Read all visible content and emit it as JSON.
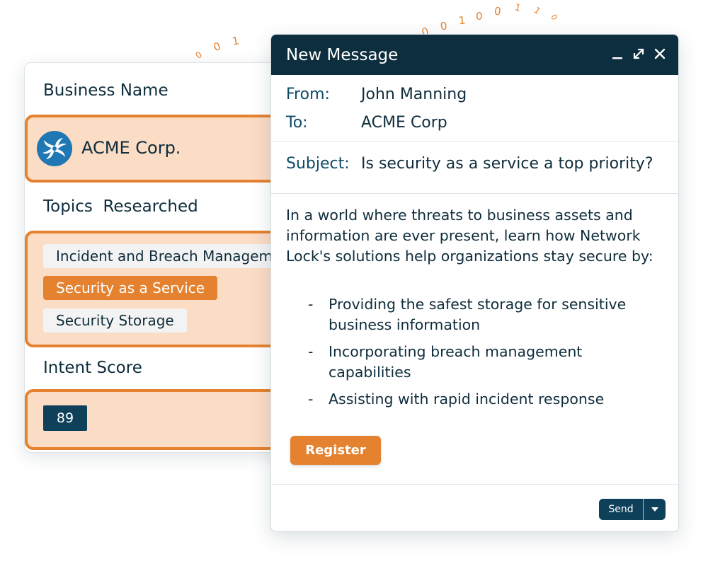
{
  "decoration": {
    "binary_left": [
      "1",
      "0",
      "0",
      "1"
    ],
    "binary_right": [
      "0",
      "0",
      "1",
      "0",
      "0",
      "1",
      "1",
      "0"
    ]
  },
  "profile": {
    "business_label": "Business Name",
    "business_name": "ACME Corp.",
    "topics_label": "Topics  Researched",
    "topics": [
      {
        "label": "Incident and Breach Management",
        "active": false
      },
      {
        "label": "Security as a Service",
        "active": true
      },
      {
        "label": "Security Storage",
        "active": false
      }
    ],
    "intent_label": "Intent Score",
    "intent_score": "89"
  },
  "message": {
    "title": "New Message",
    "controls": [
      "minimize-icon",
      "expand-icon",
      "close-icon"
    ],
    "from_label": "From:",
    "from_value": "John Manning",
    "to_label": "To:",
    "to_value": "ACME Corp",
    "subject_label": "Subject:",
    "subject_value": "Is security as a service a top priority?",
    "body": "In a world where threats to business assets and information are ever present, learn how Network Lock's solutions help organizations stay secure by:",
    "bullets": [
      "Providing the safest storage for sensitive business information",
      "Incorporating breach management capabilities",
      "Assisting with rapid incident response"
    ],
    "bullet_marker": "-",
    "register_label": "Register",
    "send_label": "Send"
  },
  "colors": {
    "accent": "#e5822f",
    "navy": "#0d2e3e",
    "chip_bg": "#fbdcc5"
  }
}
